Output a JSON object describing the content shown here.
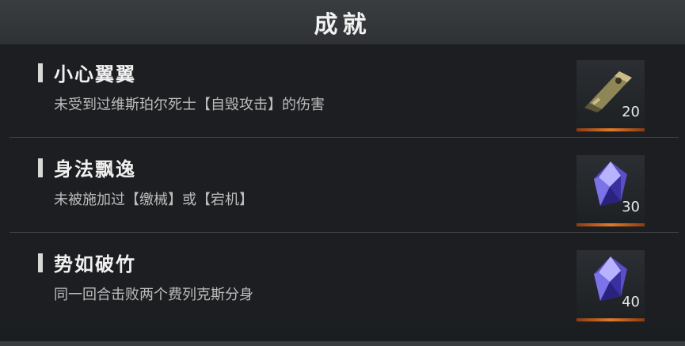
{
  "header": {
    "title": "成就"
  },
  "achievements": [
    {
      "name": "小心翼翼",
      "desc": "未受到过维斯珀尔死士【自毁攻击】的伤害",
      "reward_icon": "usb-key-icon",
      "qty": "20"
    },
    {
      "name": "身法飘逸",
      "desc": "未被施加过【缴械】或【宕机】",
      "reward_icon": "crystal-icon",
      "qty": "30"
    },
    {
      "name": "势如破竹",
      "desc": "同一回合击败两个费列克斯分身",
      "reward_icon": "crystal-icon",
      "qty": "40"
    }
  ],
  "colors": {
    "accent": "#e07a2a",
    "crystal": "#6a5fd8"
  }
}
